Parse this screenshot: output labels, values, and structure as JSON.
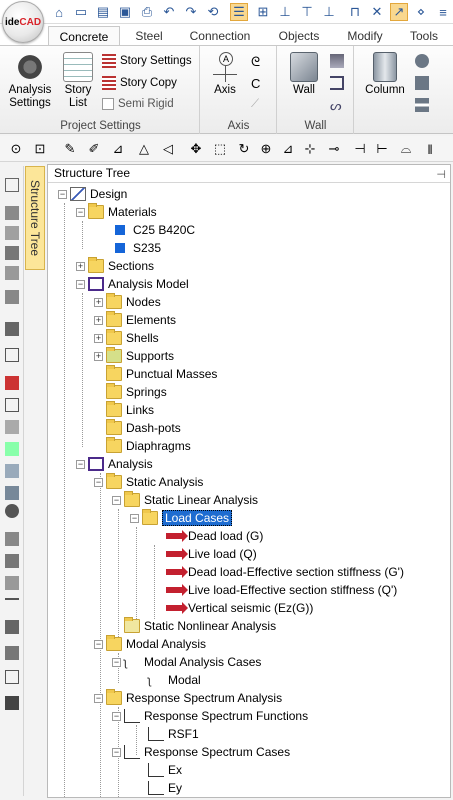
{
  "app": {
    "logo_text_black": "ide",
    "logo_text_red": "CAD"
  },
  "ribbon_tabs": [
    "Concrete",
    "Steel",
    "Connection",
    "Objects",
    "Modify",
    "Tools"
  ],
  "project_settings": {
    "group_label": "Project Settings",
    "analysis_settings": "Analysis Settings",
    "story_list": "Story List",
    "story_settings": "Story Settings",
    "story_copy": "Story Copy",
    "semi_rigid": "Semi Rigid"
  },
  "axis_group": {
    "group_label": "Axis",
    "axis_button": "Axis"
  },
  "wall_group": {
    "group_label": "Wall",
    "wall_button": "Wall"
  },
  "column_group": {
    "column_button": "Column"
  },
  "panel": {
    "title": "Structure Tree",
    "side_tab": "Structure Tree"
  },
  "tree": {
    "design": "Design",
    "materials": "Materials",
    "mat1": "C25 B420C",
    "mat2": "S235",
    "sections": "Sections",
    "analysis_model": "Analysis Model",
    "nodes": "Nodes",
    "elements": "Elements",
    "shells": "Shells",
    "supports": "Supports",
    "punctual_masses": "Punctual Masses",
    "springs": "Springs",
    "links": "Links",
    "dashpots": "Dash-pots",
    "diaphragms": "Diaphragms",
    "analysis": "Analysis",
    "static_analysis": "Static Analysis",
    "static_linear": "Static Linear Analysis",
    "load_cases": "Load Cases",
    "lc1": "Dead load (G)",
    "lc2": "Live load (Q)",
    "lc3": "Dead load-Effective section stiffness (G')",
    "lc4": "Live load-Effective section stiffness (Q')",
    "lc5": "Vertical seismic (Ez(G))",
    "static_nonlinear": "Static Nonlinear Analysis",
    "modal_analysis": "Modal Analysis",
    "modal_cases": "Modal Analysis Cases",
    "modal": "Modal",
    "rsa": "Response Spectrum Analysis",
    "rs_functions": "Response Spectrum Functions",
    "rsf1": "RSF1",
    "rs_cases": "Response Spectrum Cases",
    "ex": "Ex",
    "ey": "Ey"
  },
  "colors": {
    "accent": "#2b5797",
    "selection": "#1e6cd0",
    "load_arrow": "#c3202f",
    "folder": "#f7d560"
  }
}
